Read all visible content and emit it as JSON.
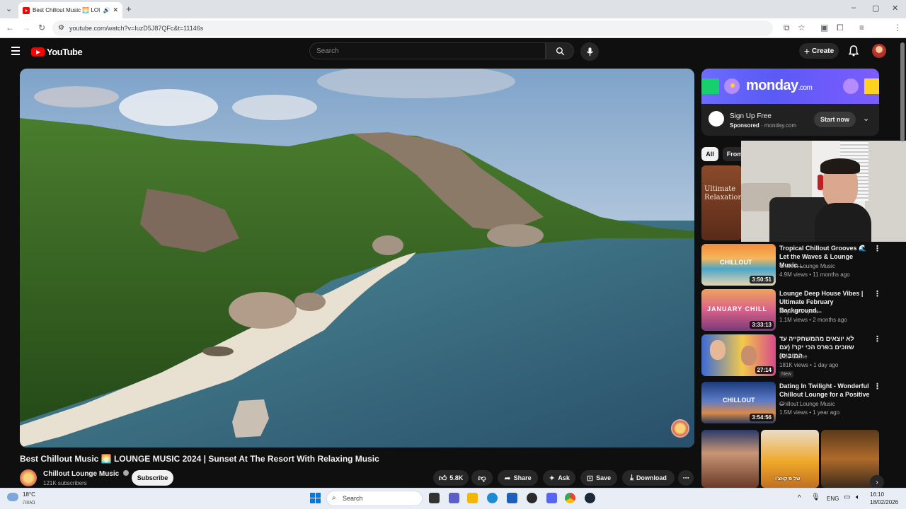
{
  "browser": {
    "tab_title": "Best Chillout Music 🌅 LOU...",
    "url": "youtube.com/watch?v=IuzD5J87QFc&t=11146s"
  },
  "header": {
    "logo_text": "YouTube",
    "search_placeholder": "Search",
    "create_label": "Create"
  },
  "video": {
    "title": "Best Chillout Music 🌅 LOUNGE MUSIC 2024 | Sunset At The Resort With Relaxing Music",
    "channel": "Chillout Lounge Music",
    "subscribers": "121K subscribers",
    "subscribe_label": "Subscribe",
    "likes": "5.8K",
    "share_label": "Share",
    "ask_label": "Ask",
    "save_label": "Save",
    "download_label": "Download"
  },
  "ad": {
    "brand": "monday",
    "brand_suffix": ".com",
    "headline": "Sign Up Free",
    "sponsored": "Sponsored",
    "domain": "· monday.com",
    "cta": "Start now"
  },
  "chips": [
    "All",
    "From"
  ],
  "recommendations": [
    {
      "title": "Ultimate Relaxation",
      "thumb_text": "Ultimate Relaxation"
    },
    {
      "title": "Tropical Chillout Grooves 🌊 Let the Waves & Lounge Music...",
      "channel": "Chillout Lounge Music",
      "meta": "4.9M views • 11 months ago",
      "duration": "3:50:51",
      "thumb_text": "CHILLOUT"
    },
    {
      "title": "Lounge Deep House Vibes | Ultimate February Background...",
      "channel": "Rhythm Depths",
      "meta": "1.1M views • 2 months ago",
      "duration": "3:33:13",
      "thumb_text": "JANUARY CHILL"
    },
    {
      "title": "לא יוצאים מהמשחקייה עד שזוכים בפרס הכי יקר! (עם המוביס)",
      "channel": "Inde Game",
      "meta": "181K views • 1 day ago",
      "badge": "New",
      "duration": "27:14"
    },
    {
      "title": "Dating In Twilight - Wonderful Chillout Lounge for a Positive ...",
      "channel": "Chillout Lounge Music",
      "meta": "1.5M views • 1 year ago",
      "duration": "3:54:56",
      "thumb_text": "CHILLOUT"
    }
  ],
  "shorts_caption": "של פיקאצ'ו",
  "taskbar": {
    "temp": "18°C",
    "weather": "נאווה",
    "search_label": "Search",
    "lang": "ENG",
    "time": "16:10",
    "date": "18/02/2026"
  }
}
